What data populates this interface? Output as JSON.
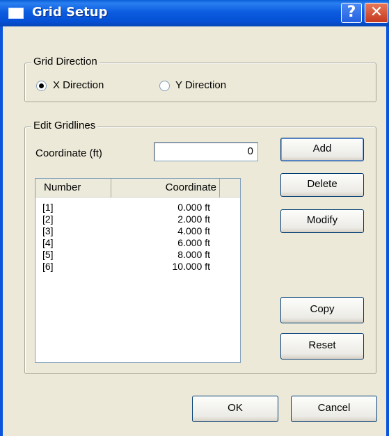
{
  "window": {
    "title": "Grid Setup"
  },
  "title_buttons": {
    "help": "?",
    "close": "✕"
  },
  "grid_direction": {
    "legend": "Grid Direction",
    "options": [
      {
        "label": "X Direction",
        "checked": true
      },
      {
        "label": "Y Direction",
        "checked": false
      }
    ]
  },
  "edit_gridlines": {
    "legend": "Edit Gridlines",
    "coordinate_label": "Coordinate (ft)",
    "coordinate_value": "0",
    "columns": [
      "Number",
      "Coordinate"
    ],
    "rows": [
      {
        "number": "[1]",
        "coordinate": "0.000 ft"
      },
      {
        "number": "[2]",
        "coordinate": "2.000 ft"
      },
      {
        "number": "[3]",
        "coordinate": "4.000 ft"
      },
      {
        "number": "[4]",
        "coordinate": "6.000 ft"
      },
      {
        "number": "[5]",
        "coordinate": "8.000 ft"
      },
      {
        "number": "[6]",
        "coordinate": "10.000 ft"
      }
    ],
    "buttons": {
      "add": "Add",
      "delete": "Delete",
      "modify": "Modify",
      "copy": "Copy",
      "reset": "Reset"
    }
  },
  "footer": {
    "ok": "OK",
    "cancel": "Cancel"
  },
  "colors": {
    "titlebar": "#0a5fd8",
    "dialog_bg": "#ece9d8",
    "close_button": "#c4391e"
  }
}
